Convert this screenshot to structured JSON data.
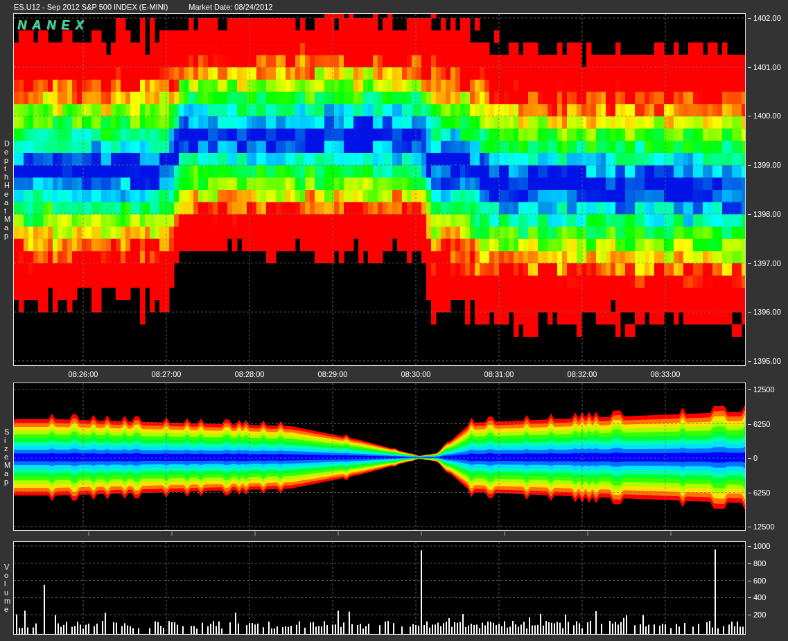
{
  "header": {
    "instrument": "ES.U12 - Sep 2012 S&P 500 INDEX (E-MINI)",
    "market_date": "Market Date: 08/24/2012"
  },
  "logo": "NANEX",
  "heat_map": {
    "label": "Depth Heat Map",
    "yticks": [
      "1402.00",
      "1401.00",
      "1400.00",
      "1399.00",
      "1398.00",
      "1397.00",
      "1396.00",
      "1395.00"
    ]
  },
  "time_axis": [
    "08:26:00",
    "08:27:00",
    "08:28:00",
    "08:29:00",
    "08:30:00",
    "08:31:00",
    "08:32:00",
    "08:33:00"
  ],
  "size_map": {
    "label": "Size Map",
    "yticks": [
      "12500",
      "6250",
      "0",
      "6250",
      "12500"
    ]
  },
  "volume": {
    "label": "Volume",
    "yticks": [
      "1000",
      "800",
      "600",
      "400",
      "200"
    ]
  }
}
